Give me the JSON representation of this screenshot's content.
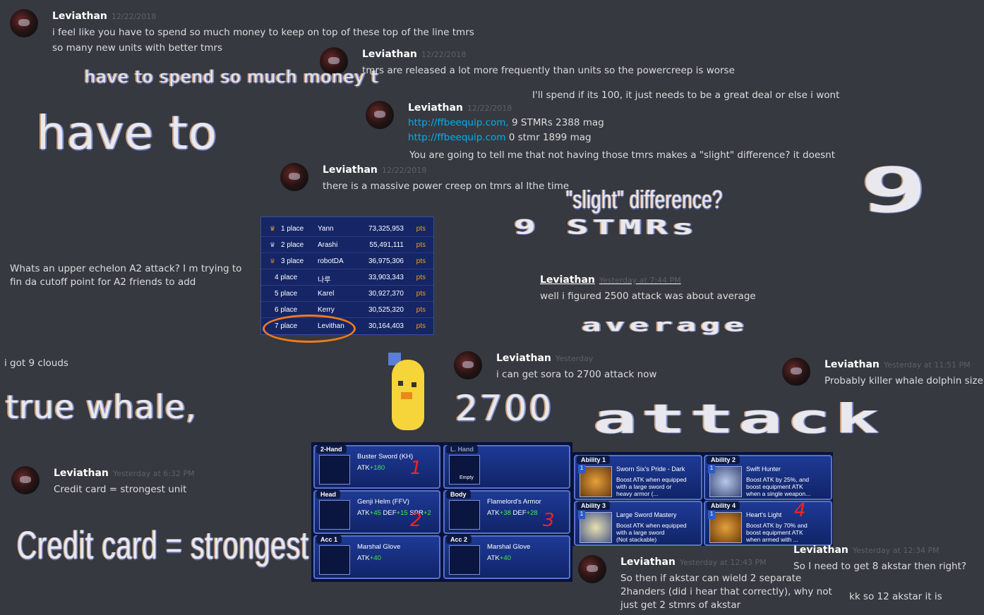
{
  "colors": {
    "background": "#36393f",
    "link": "#00b0f4",
    "circle": "#f07a1c",
    "numbers": "#ff2020"
  },
  "msgs": {
    "m1": {
      "user": "Leviathan",
      "time": "12/22/2018",
      "l1": "i feel like you have to spend so much money to keep on top of these top of the line tmrs",
      "l2": "so many  new units with better tmrs"
    },
    "m2": {
      "user": "Leviathan",
      "time": "12/22/2018",
      "l1": "tmrs are released a lot more frequently than units so the powercreep is worse"
    },
    "m2b": "I'll spend if its 100, it just needs to be a great deal or else i wont",
    "m3": {
      "user": "Leviathan",
      "time": "12/22/2018",
      "link1": "http://ffbeequip.com,",
      "after1": "9 STMRs 2388 mag",
      "link2": "http://ffbeequip.com",
      "after2": "0 stmr 1899 mag",
      "l3": "You are going to tell me that not having those tmrs makes a \"slight\" difference?  it doesnt"
    },
    "m4": {
      "user": "Leviathan",
      "time": "12/22/2018",
      "l1": "there is a massive power creep on tmrs al lthe time"
    },
    "m5": {
      "l1": "Whats an upper echelon A2 attack?  I m trying to",
      "l2": "fin da cutoff point for A2 friends to add"
    },
    "m6": {
      "user": "Leviathan",
      "time": "Yesterday at 7:44 PM",
      "l1": "well i figured 2500 attack was about average"
    },
    "m7": "i got 9 clouds",
    "m8": {
      "user": "Leviathan",
      "time": "Yesterday",
      "l1": "i can get sora to 2700 attack now"
    },
    "m9": {
      "user": "Leviathan",
      "time": "Yesterday at 11:51 PM",
      "l1": "Probably killer whale dolphin size"
    },
    "m10": {
      "user": "Leviathan",
      "time": "Yesterday at 6:32 PM",
      "l1": "Credit card = strongest unit"
    },
    "m11": {
      "user": "Leviathan",
      "time": "Yesterday at 12:43 PM",
      "l1": "So then if akstar can wield 2 separate",
      "l2": "2handers (did i hear that correctly), why not",
      "l3": "just get 2 stmrs of akstar"
    },
    "m12": {
      "user": "Leviathan",
      "time": "Yesterday at 12:34 PM",
      "l1": "So I need to get 8 akstar then right?"
    },
    "m13": "kk so 12 akstar it is"
  },
  "overlays": {
    "o1": "have to spend so much money t",
    "o2": "have to",
    "o3": "\"slight\" difference?",
    "o4": "9 STMRs",
    "o5": "9",
    "o6": "average",
    "o7": "true whale,",
    "o8": "2700",
    "o9": "attack",
    "o10": "Credit card = strongest unit"
  },
  "leaderboard": {
    "rows": [
      {
        "place": "1 place",
        "name": "Yann",
        "score": "73,325,953",
        "pts": "pts"
      },
      {
        "place": "2 place",
        "name": "Arashi",
        "score": "55,491,111",
        "pts": "pts"
      },
      {
        "place": "3 place",
        "name": "robotDA",
        "score": "36,975,306",
        "pts": "pts"
      },
      {
        "place": "4 place",
        "name": "나루",
        "score": "33,903,343",
        "pts": "pts"
      },
      {
        "place": "5 place",
        "name": "Karel",
        "score": "30,927,370",
        "pts": "pts"
      },
      {
        "place": "6 place",
        "name": "Kerry",
        "score": "30,525,320",
        "pts": "pts"
      },
      {
        "place": "7 place",
        "name": "Levithan",
        "score": "30,164,403",
        "pts": "pts"
      }
    ]
  },
  "equipment": {
    "s1": {
      "label": "2-Hand",
      "name": "Buster Sword (KH)",
      "stat": "ATK",
      "val": "+180"
    },
    "s2": {
      "label": "L. Hand",
      "empty": "Empty"
    },
    "s3": {
      "label": "Head",
      "name": "Genji Helm (FFV)",
      "s1": "ATK",
      "v1": "+45",
      "s2": "DEF",
      "v2": "+15",
      "s3": "SPR",
      "v3": "+2"
    },
    "s4": {
      "label": "Body",
      "name": "Flamelord's Armor",
      "s1": "ATK",
      "v1": "+38",
      "s2": "DEF",
      "v2": "+28"
    },
    "s5": {
      "label": "Acc 1",
      "name": "Marshal Glove",
      "stat": "ATK",
      "val": "+40"
    },
    "s6": {
      "label": "Acc 2",
      "name": "Marshal Glove",
      "stat": "ATK",
      "val": "+40"
    },
    "n1": "1",
    "n2": "2",
    "n3": "3"
  },
  "abilities": {
    "a1": {
      "label": "Ability 1",
      "lv": "1",
      "name": "Sworn Six's Pride - Dark",
      "desc": "Boost ATK when equipped\nwith a large sword or\nheavy armor (..."
    },
    "a2": {
      "label": "Ability 2",
      "lv": "1",
      "name": "Swift Hunter",
      "desc": "Boost ATK by 25%, and\nboost equipment ATK\nwhen a single weapon..."
    },
    "a3": {
      "label": "Ability 3",
      "lv": "1",
      "name": "Large Sword Mastery",
      "desc": "Boost ATK when equipped\nwith a large sword\n(Not stackable)"
    },
    "a4": {
      "label": "Ability 4",
      "lv": "1",
      "name": "Heart's Light",
      "desc": "Boost ATK by 70% and\nboost equipment ATK\nwhen armed with ..."
    },
    "n4": "4"
  }
}
